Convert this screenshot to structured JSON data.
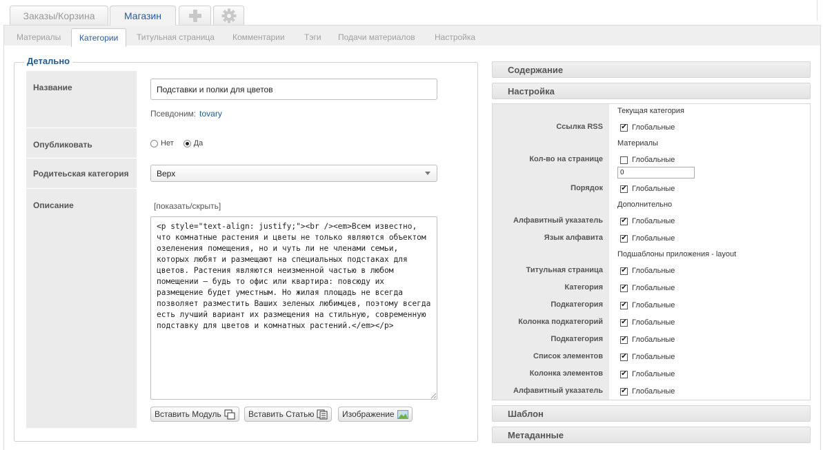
{
  "top_tabs": {
    "orders": "Заказы/Корзина",
    "shop": "Магазин",
    "add_icon": "plus-icon",
    "settings_icon": "gear-icon"
  },
  "sub_tabs": [
    "Материалы",
    "Категории",
    "Титульная страница",
    "Комментарии",
    "Тэги",
    "Подачи материалов",
    "Настройка"
  ],
  "details": {
    "legend": "Детально",
    "name_label": "Название",
    "name_value": "Подставки и полки для цветов",
    "alias_label": "Псевдоним:",
    "alias_value": "tovary",
    "publish_label": "Опубликовать",
    "publish_no": "Нет",
    "publish_yes": "Да",
    "publish_selected": "Да",
    "parent_label": "Родитеьская категория",
    "parent_value": "Верх",
    "description_label": "Описание",
    "toggle_link": "[показать/скрыть]",
    "description_value": "<p style=\"text-align: justify;\"><br /><em>Всем известно, что комнатные растения и цветы не только являются объектом озеленения помещения, но и чуть ли не членами семьи, которых любят и размещают на специальных подстаках для цветов. Растения являются неизменной частью в любом помещении – будь то офис или квартира: повсюду их размещение будет уместным. Но жилая площадь не всегда позволяет разместить Ваших зеленых любимцев, поэтому всегда есть лучший вариант их размещения на стильную, современную подставку для цветов и комнатных растений.</em></p>",
    "btn_module": "Вставить Модуль",
    "btn_article": "Вставить Статью",
    "btn_image": "Изображение"
  },
  "right_panels": {
    "content": "Содержание",
    "settings": "Настройка",
    "template": "Шаблон",
    "metadata": "Метаданные"
  },
  "settings": {
    "global_label": "Глобальные",
    "section_current": "Текущая категория",
    "rss_label": "Ссылка RSS",
    "rss_global": true,
    "section_materials": "Материалы",
    "per_page_label": "Кол-во на странице",
    "per_page_global": false,
    "per_page_value": "0",
    "order_label": "Порядок",
    "order_global": true,
    "section_extra": "Дополнительно",
    "alpha_index_label": "Алфавитный указатель",
    "alpha_index_global": true,
    "alpha_lang_label": "Язык алфавита",
    "alpha_lang_global": true,
    "section_subtemplates": "Подшаблоны приложения - layout",
    "subtemplates": [
      {
        "label": "Титульная страница",
        "global": true
      },
      {
        "label": "Категория",
        "global": true
      },
      {
        "label": "Подкатегория",
        "global": true
      },
      {
        "label": "Колонка подкатегорий",
        "global": true
      },
      {
        "label": "Подкатегория",
        "global": true
      },
      {
        "label": "Список элементов",
        "global": true
      },
      {
        "label": "Колонка элементов",
        "global": true
      },
      {
        "label": "Алфавитный указатель",
        "global": true
      }
    ]
  }
}
